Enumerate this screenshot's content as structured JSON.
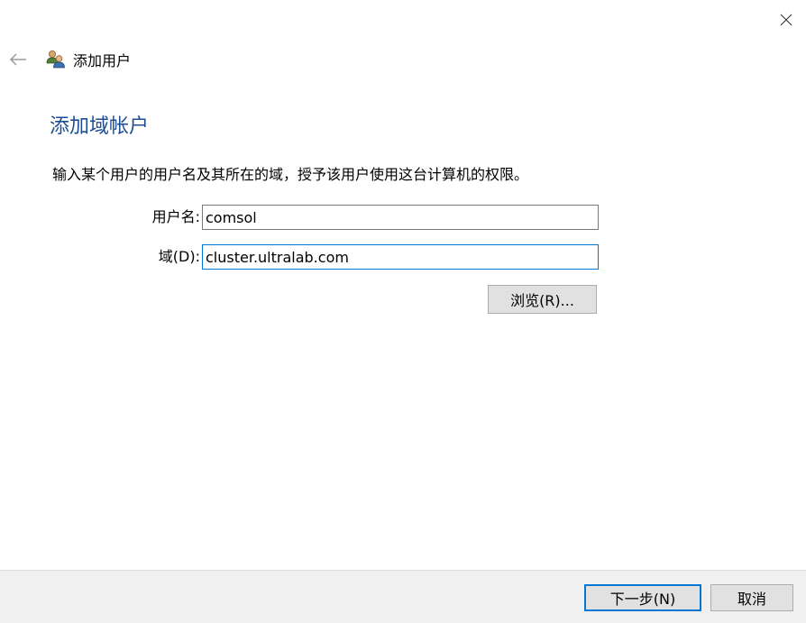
{
  "window": {
    "close_glyph": "✕"
  },
  "nav": {
    "back_icon": "back-arrow-icon",
    "app_icon": "users-icon",
    "title": "添加用户"
  },
  "page": {
    "heading": "添加域帐户",
    "instruction": "输入某个用户的用户名及其所在的域，授予该用户使用这台计算机的权限。"
  },
  "form": {
    "username_label": "用户名:",
    "username_value": "comsol",
    "domain_label": "域(D):",
    "domain_value": "cluster.ultralab.com",
    "browse_label": "浏览(R)..."
  },
  "footer": {
    "next_label": "下一步(N)",
    "cancel_label": "取消"
  },
  "colors": {
    "heading": "#1e4e94",
    "focus_border": "#0078d7",
    "footer_bg": "#f0f0f0",
    "button_bg": "#e1e1e1"
  }
}
